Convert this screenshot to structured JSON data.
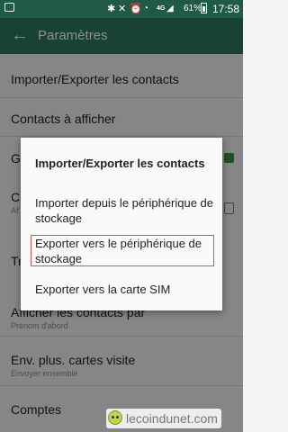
{
  "status_bar": {
    "battery_pct": "61%",
    "network": "4G",
    "time": "17:58"
  },
  "app_bar": {
    "title": "Paramètres"
  },
  "settings": {
    "items": [
      {
        "title": "Importer/Exporter les contacts"
      },
      {
        "title": "Contacts à afficher"
      },
      {
        "title": "G"
      },
      {
        "title": "C",
        "subtitle": "Af"
      },
      {
        "title": "Tr"
      },
      {
        "title": "Afficher les contacts par",
        "subtitle": "Prénom d'abord"
      },
      {
        "title": "Env. plus. cartes visite",
        "subtitle": "Envoyer ensemble"
      },
      {
        "title": "Comptes"
      }
    ]
  },
  "dialog": {
    "title": "Importer/Exporter les contacts",
    "options": [
      "Importer depuis le périphérique de stockage",
      "Exporter vers le périphérique de stockage",
      "Exporter vers la carte SIM"
    ]
  },
  "watermark": {
    "text": "lecoindunet.com"
  },
  "colors": {
    "status_bar": "#1f5a47",
    "app_bar": "#2c7a60",
    "checkbox_green": "#2e9a4a",
    "highlight_border": "#d9534f"
  }
}
